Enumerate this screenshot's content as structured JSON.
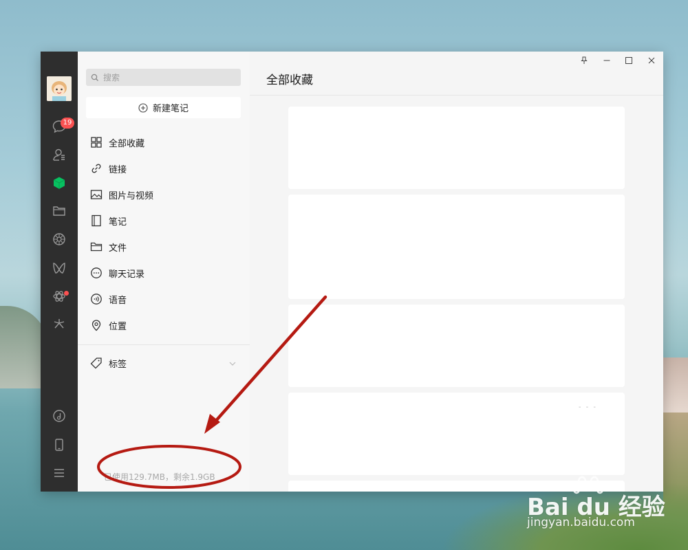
{
  "rail": {
    "chat_badge": "19",
    "icons": [
      "chat-icon",
      "contacts-icon",
      "favorites-icon",
      "folder-icon",
      "moments-icon",
      "channels-icon",
      "mini-program-icon",
      "search-discover-icon",
      "music-icon",
      "phone-icon",
      "menu-icon"
    ],
    "favorites_color": "#07c160",
    "badge_color": "#fa5151"
  },
  "sidebar": {
    "search_placeholder": "搜索",
    "new_note_label": "新建笔记",
    "items": [
      {
        "label": "全部收藏",
        "icon": "grid-icon"
      },
      {
        "label": "链接",
        "icon": "link-icon"
      },
      {
        "label": "图片与视频",
        "icon": "image-icon"
      },
      {
        "label": "笔记",
        "icon": "notebook-icon"
      },
      {
        "label": "文件",
        "icon": "folder-icon"
      },
      {
        "label": "聊天记录",
        "icon": "chat-bubble-icon"
      },
      {
        "label": "语音",
        "icon": "voice-icon"
      },
      {
        "label": "位置",
        "icon": "location-icon"
      }
    ],
    "tags_label": "标签",
    "storage_text": "已使用129.7MB，剩余1.9GB"
  },
  "main": {
    "title": "全部收藏",
    "card_dashes": "- - -"
  },
  "watermark": {
    "brand": "Bai du 经验",
    "url": "jingyan.baidu.com"
  },
  "annotation": {
    "color": "#b51a12"
  }
}
